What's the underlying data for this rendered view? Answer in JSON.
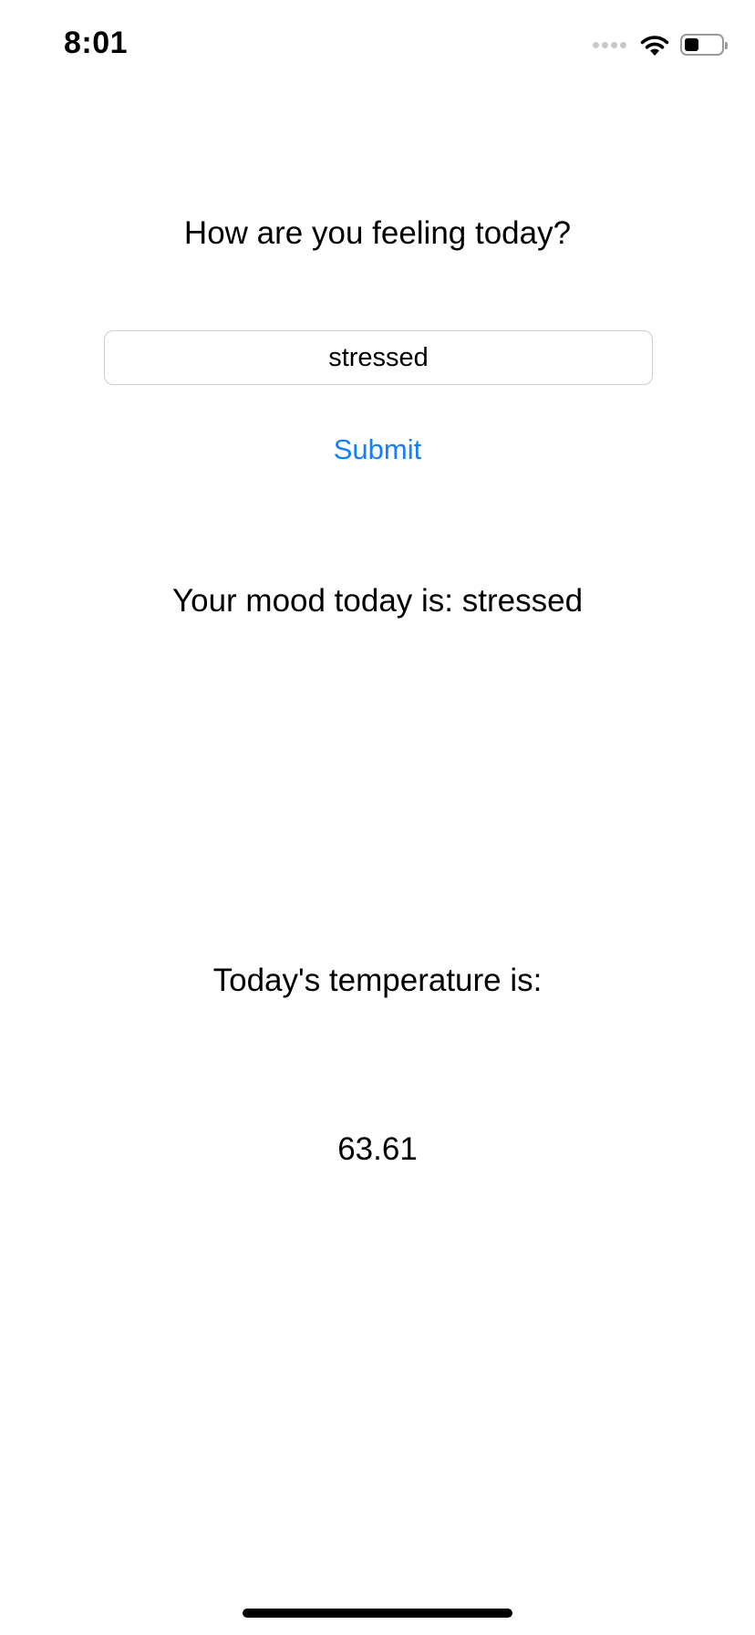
{
  "status_bar": {
    "time": "8:01",
    "battery_level": 0.4,
    "icons": [
      "signal-dots-icon",
      "wifi-icon",
      "battery-icon"
    ]
  },
  "prompt": {
    "question": "How are you feeling today?"
  },
  "mood_input": {
    "value": "stressed",
    "placeholder": ""
  },
  "submit": {
    "label": "Submit",
    "color": "#147efb"
  },
  "result": {
    "mood_text": "Your mood today is: stressed"
  },
  "temperature": {
    "label": "Today's temperature is:",
    "value": "63.61"
  }
}
